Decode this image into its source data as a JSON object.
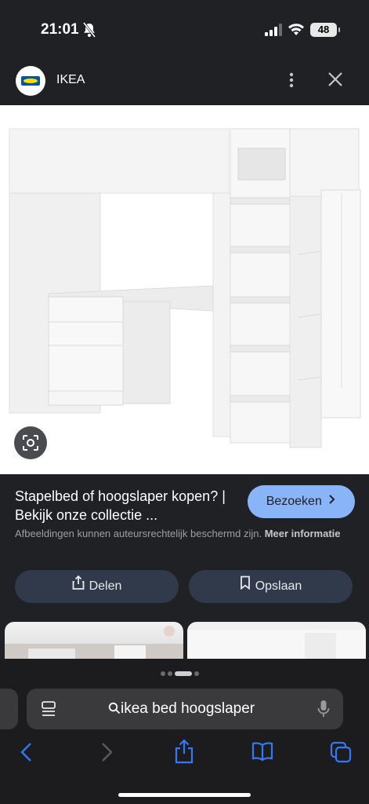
{
  "status_bar": {
    "time": "21:01",
    "battery": "48"
  },
  "header": {
    "site_name": "IKEA",
    "logo_text": "IKEA"
  },
  "result": {
    "title": "Stapelbed of hoogslaper kopen? | Bekijk onze collectie ...",
    "visit_button": "Bezoeken",
    "copyright_text": "Afbeeldingen kunnen auteursrechtelijk beschermd zijn.",
    "more_info_link": "Meer informatie",
    "share_button": "Delen",
    "save_button": "Opslaan"
  },
  "browser": {
    "address_text": "ikea bed hoogslaper"
  },
  "icons": [
    "bell-slash-icon",
    "cellular-signal-icon",
    "wifi-icon",
    "battery-icon",
    "more-vert-icon",
    "close-icon",
    "lens-icon",
    "chevron-right-icon",
    "share-icon",
    "bookmark-icon",
    "tab-list-icon",
    "search-icon",
    "mic-icon",
    "back-icon",
    "forward-icon",
    "share-sheet-icon",
    "bookmarks-icon",
    "tabs-icon"
  ],
  "colors": {
    "accent": "#8ab4f8",
    "browser_blue": "#3478f6",
    "pill_bg": "#303a4a"
  }
}
